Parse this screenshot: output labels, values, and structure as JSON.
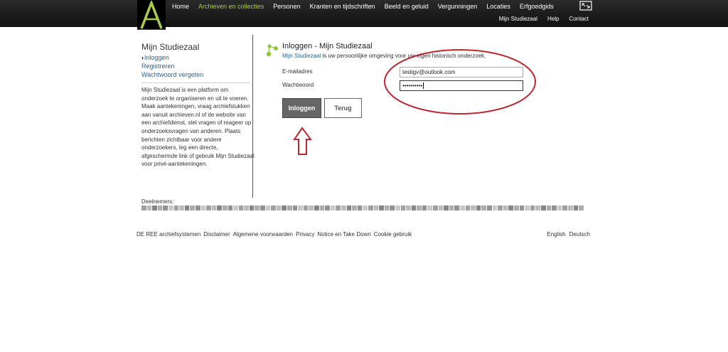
{
  "nav": {
    "items": [
      {
        "label": "Home",
        "active": false
      },
      {
        "label": "Archieven en collecties",
        "active": true
      },
      {
        "label": "Personen",
        "active": false
      },
      {
        "label": "Kranten en tijdschriften",
        "active": false
      },
      {
        "label": "Beeld en geluid",
        "active": false
      },
      {
        "label": "Vergunningen",
        "active": false
      },
      {
        "label": "Locaties",
        "active": false
      },
      {
        "label": "Erfgoedgids",
        "active": false
      }
    ],
    "sub": [
      "Mijn Studiezaal",
      "Help",
      "Contact"
    ],
    "logo_letter": "A"
  },
  "sidebar": {
    "title": "Mijn Studiezaal",
    "links": [
      "Inloggen",
      "Registreren",
      "Wachtwoord vergeten"
    ],
    "description": "Mijn Studiezaal is een platform om onderzoek te organiseren en uit te voeren. Maak aantekeningen, vraag archiefstukken aan vanuit archieven.nl of de website van een archiefdienst, stel vragen of reageer op onderzoeksvragen van anderen. Plaats berichten zichtbaar voor andere onderzoekers, leg een directe, afgeschermde link of gebruik Mijn Studiezaal voor privé-aantekeningen."
  },
  "login": {
    "title": "Inloggen - Mijn Studiezaal",
    "subtitle_link": "Mijn Studiezaal",
    "subtitle_rest": " is uw persoonlijke omgeving voor uw eigen historisch onderzoek.",
    "email_label": "E-mailadres",
    "email_value": "testigv@outlook.com",
    "password_label": "Wachtwoord",
    "password_value": "••••••••••",
    "login_button": "Inloggen",
    "back_button": "Terug"
  },
  "participants": {
    "title": "Deelnemers:"
  },
  "footer": {
    "links": [
      "DE REE archiefsystemen",
      "Disclaimer",
      "Algemene voorwaarden",
      "Privacy",
      "Notice en Take Down",
      "Cookie gebruik"
    ],
    "languages": [
      "English",
      "Deutsch"
    ]
  },
  "colors": {
    "accent": "#a9cd4a",
    "link": "#2a6496",
    "annotation": "#c0272d"
  }
}
